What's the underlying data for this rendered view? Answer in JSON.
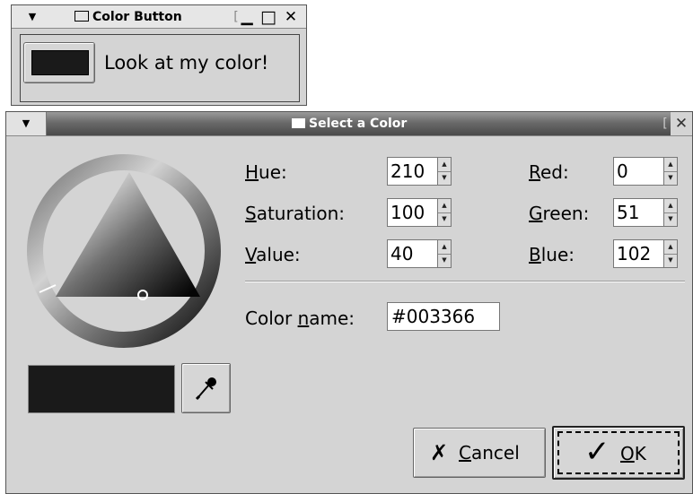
{
  "color_button_window": {
    "menu_glyph": "▼",
    "title": "Color Button",
    "title_sep": "[",
    "minimize_glyph": "▁",
    "maximize_glyph": "□",
    "close_glyph": "✕",
    "label": "Look at my color!",
    "swatch_color": "#1a1a1a"
  },
  "color_dialog": {
    "menu_glyph": "▼",
    "title": "Select a Color",
    "title_sep": "[",
    "close_glyph": "✕",
    "fields": {
      "hue": {
        "mnemonic": "H",
        "rest": "ue:",
        "value": "210"
      },
      "saturation": {
        "mnemonic": "S",
        "rest": "aturation:",
        "value": "100"
      },
      "value": {
        "mnemonic": "V",
        "rest": "alue:",
        "value": "40"
      },
      "red": {
        "mnemonic": "R",
        "rest": "ed:",
        "value": "0"
      },
      "green": {
        "mnemonic": "G",
        "rest": "reen:",
        "value": "51"
      },
      "blue": {
        "mnemonic": "B",
        "rest": "lue:",
        "value": "102"
      }
    },
    "spin_up": "▲",
    "spin_down": "▼",
    "color_name": {
      "pre": "Color ",
      "mnemonic": "n",
      "rest": "ame:",
      "value": "#003366"
    },
    "preview_color": "#1a1a1a",
    "eyedropper_icon": "eyedropper",
    "cancel": {
      "icon": "✗",
      "mnemonic": "C",
      "rest": "ancel"
    },
    "ok": {
      "icon": "✓",
      "mnemonic": "O",
      "rest": "K"
    }
  }
}
